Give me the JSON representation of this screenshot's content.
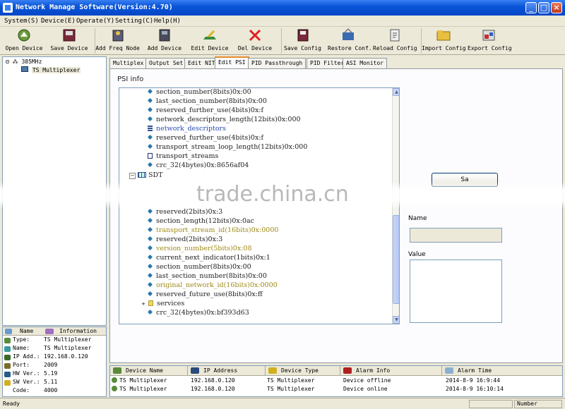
{
  "window": {
    "title": "Network Manage Software(Version:4.70)"
  },
  "menu": [
    "System(S)",
    "Device(E)",
    "Operate(Y)",
    "Setting(C)",
    "Help(H)"
  ],
  "toolbar": [
    {
      "label": "Open Device",
      "icon": "open-device-icon"
    },
    {
      "label": "Save Device",
      "icon": "save-device-icon"
    },
    {
      "label": "Add Freq Node",
      "icon": "add-freq-node-icon"
    },
    {
      "label": "Add Device",
      "icon": "add-device-icon"
    },
    {
      "label": "Edit Device",
      "icon": "edit-device-icon"
    },
    {
      "label": "Del Device",
      "icon": "delete-icon"
    },
    {
      "label": "Save Config",
      "icon": "save-config-icon"
    },
    {
      "label": "Restore Conf.",
      "icon": "restore-config-icon"
    },
    {
      "label": "Reload Config",
      "icon": "reload-config-icon"
    },
    {
      "label": "Import Config",
      "icon": "import-config-icon"
    },
    {
      "label": "Export Config",
      "icon": "export-config-icon"
    }
  ],
  "tree": {
    "root": "385MHz",
    "child": "TS Multiplexer"
  },
  "info": {
    "headers": [
      "Name",
      "Information"
    ],
    "rows": [
      {
        "key": "Type:",
        "value": "TS Multiplexer"
      },
      {
        "key": "Name:",
        "value": "TS Multiplexer"
      },
      {
        "key": "IP Add.:",
        "value": "192.168.0.120"
      },
      {
        "key": "Port:",
        "value": "2009"
      },
      {
        "key": "HW Ver.:",
        "value": "5.19"
      },
      {
        "key": "SW Ver.:",
        "value": "5.11"
      },
      {
        "key": "Code:",
        "value": "4000"
      }
    ]
  },
  "tabs": [
    "Multiplex",
    "Output Set",
    "Edit NIT",
    "Edit PSI",
    "PID Passthrough",
    "PID Filter",
    "ASI Monitor"
  ],
  "psi": {
    "label": "PSI info",
    "rows_top": [
      {
        "text": "section_number(8bits)0x:00",
        "icon": "diamond",
        "style": ""
      },
      {
        "text": "last_section_number(8bits)0x:00",
        "icon": "diamond",
        "style": ""
      },
      {
        "text": "reserved_further_use(4bits)0x:f",
        "icon": "diamond",
        "style": ""
      },
      {
        "text": "network_descriptors_length(12bits)0x:000",
        "icon": "diamond",
        "style": ""
      },
      {
        "text": "network_descriptors",
        "icon": "list",
        "style": "blue"
      },
      {
        "text": "reserved_further_use(4bits)0x:f",
        "icon": "diamond",
        "style": ""
      },
      {
        "text": "transport_stream_loop_length(12bits)0x:000",
        "icon": "diamond",
        "style": ""
      },
      {
        "text": "transport_streams",
        "icon": "box",
        "style": ""
      },
      {
        "text": "crc_32(4bytes)0x:8656af04",
        "icon": "diamond",
        "style": ""
      }
    ],
    "sdt_label": "SDT",
    "rows_bottom": [
      {
        "text": "reserved(2bits)0x:3",
        "icon": "diamond",
        "style": ""
      },
      {
        "text": "section_length(12bits)0x:0ac",
        "icon": "diamond",
        "style": ""
      },
      {
        "text": "transport_stream_id(16bits)0x:0000",
        "icon": "diamond",
        "style": "olive"
      },
      {
        "text": "reserved(2bits)0x:3",
        "icon": "diamond",
        "style": ""
      },
      {
        "text": "version_number(5bits)0x:08",
        "icon": "diamond",
        "style": "olive"
      },
      {
        "text": "current_next_indicator(1bits)0x:1",
        "icon": "diamond",
        "style": ""
      },
      {
        "text": "section_number(8bits)0x:00",
        "icon": "diamond",
        "style": ""
      },
      {
        "text": "last_section_number(8bits)0x:00",
        "icon": "diamond",
        "style": ""
      },
      {
        "text": "original_network_id(16bits)0x:0000",
        "icon": "diamond",
        "style": "olive"
      },
      {
        "text": "reserved_future_use(8bits)0x:ff",
        "icon": "diamond",
        "style": ""
      },
      {
        "text": "services",
        "icon": "folder",
        "style": "",
        "expander": "+"
      },
      {
        "text": "crc_32(4bytes)0x:bf393d63",
        "icon": "diamond",
        "style": ""
      }
    ]
  },
  "right": {
    "button_label": "Sa",
    "name_label": "Name",
    "name_value": "",
    "value_label": "Value",
    "value_value": ""
  },
  "watermark": "trade.china.cn",
  "devices": {
    "headers": [
      "Device Name",
      "IP Address",
      "Device Type",
      "Alarm Info",
      "Alarm Time"
    ],
    "rows": [
      [
        "TS Multiplexer",
        "192.168.0.120",
        "TS Multiplexer",
        "Device offline",
        "2014-8-9 16:9:44"
      ],
      [
        "TS Multiplexer",
        "192.168.0.120",
        "TS Multiplexer",
        "Device online",
        "2014-8-9 16:10:14"
      ]
    ]
  },
  "status": {
    "text": "Ready",
    "number_label": "Number"
  },
  "colors": {
    "titlebar": "#0a56d8",
    "olive_text": "#a08a18",
    "blue_text": "#2a4cb0"
  }
}
